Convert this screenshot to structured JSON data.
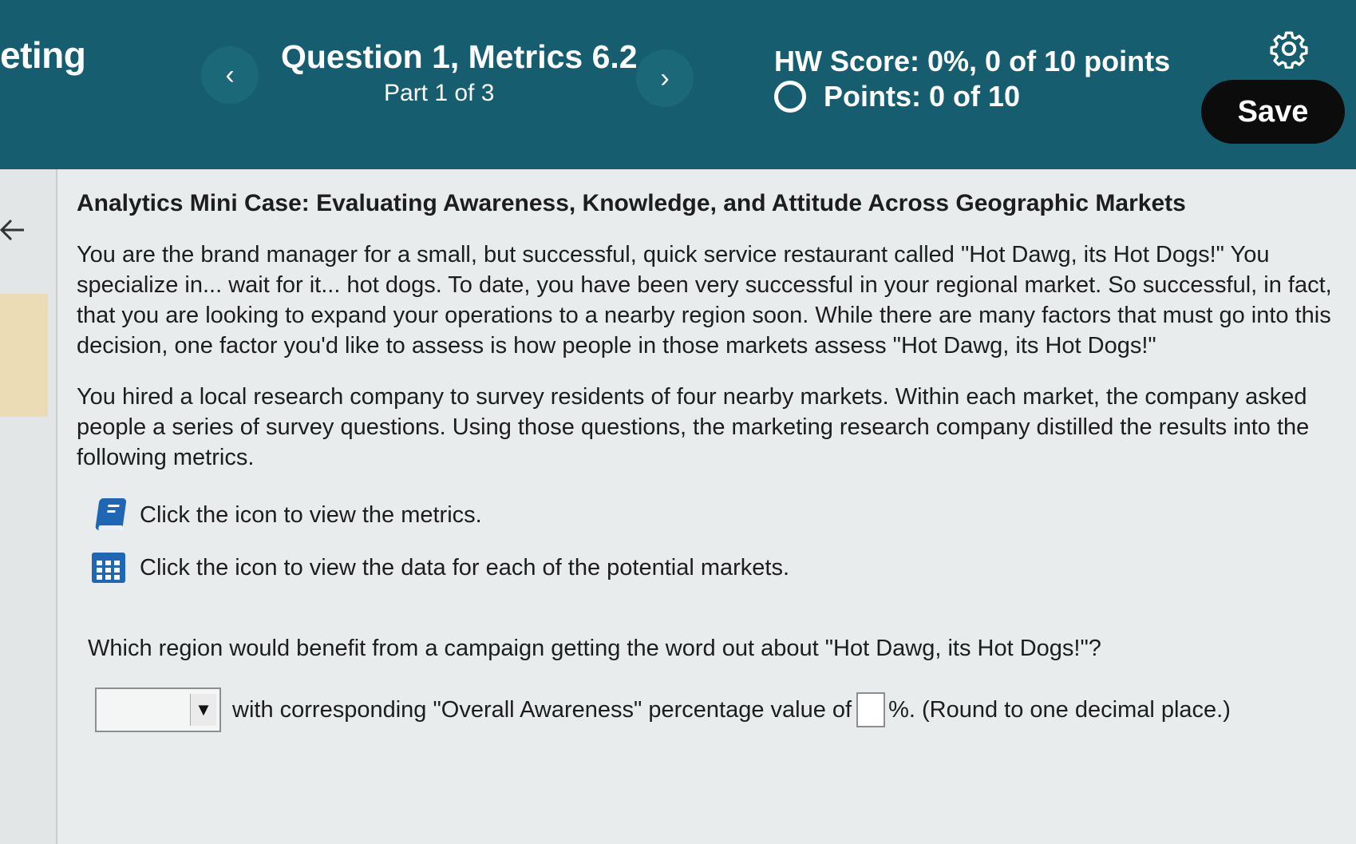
{
  "header": {
    "course_fragment": "eting",
    "prev_label": "‹",
    "next_label": "›",
    "question_title": "Question 1, Metrics 6.2",
    "part": "Part 1 of 3",
    "hw_score": "HW Score: 0%, 0 of 10 points",
    "points": "Points: 0 of 10",
    "save_label": "Save"
  },
  "content": {
    "case_title": "Analytics Mini Case: Evaluating Awareness, Knowledge, and Attitude Across Geographic Markets",
    "para1": "You are the brand manager for a small, but successful, quick service restaurant called \"Hot Dawg, its Hot Dogs!\" You specialize in... wait for it... hot dogs. To date, you have been very successful in your regional market. So successful, in fact, that you are looking to expand your operations to a nearby region soon. While there are many factors that must go into this decision, one factor you'd like to assess is how people in those markets assess \"Hot Dawg, its Hot Dogs!\"",
    "para2": "You hired a local research company to survey residents of four nearby markets. Within each market, the company asked people a series of survey questions. Using those questions, the marketing research company distilled the results into the following metrics.",
    "metrics_link": "Click the icon to view the metrics.",
    "data_link": "Click the icon to view the data for each of the potential markets.",
    "question": "Which region would benefit from a campaign getting the word out about \"Hot Dawg, its Hot Dogs!\"?",
    "answer_text_1": "with corresponding \"Overall Awareness\" percentage value of",
    "answer_text_2": "%. (Round to one decimal place.)",
    "select_value": "",
    "input_value": ""
  },
  "colors": {
    "header_bg": "#165e6f",
    "save_bg": "#0c0c0c",
    "book_icon": "#1f67b4",
    "grid_icon": "#1f67b4"
  }
}
